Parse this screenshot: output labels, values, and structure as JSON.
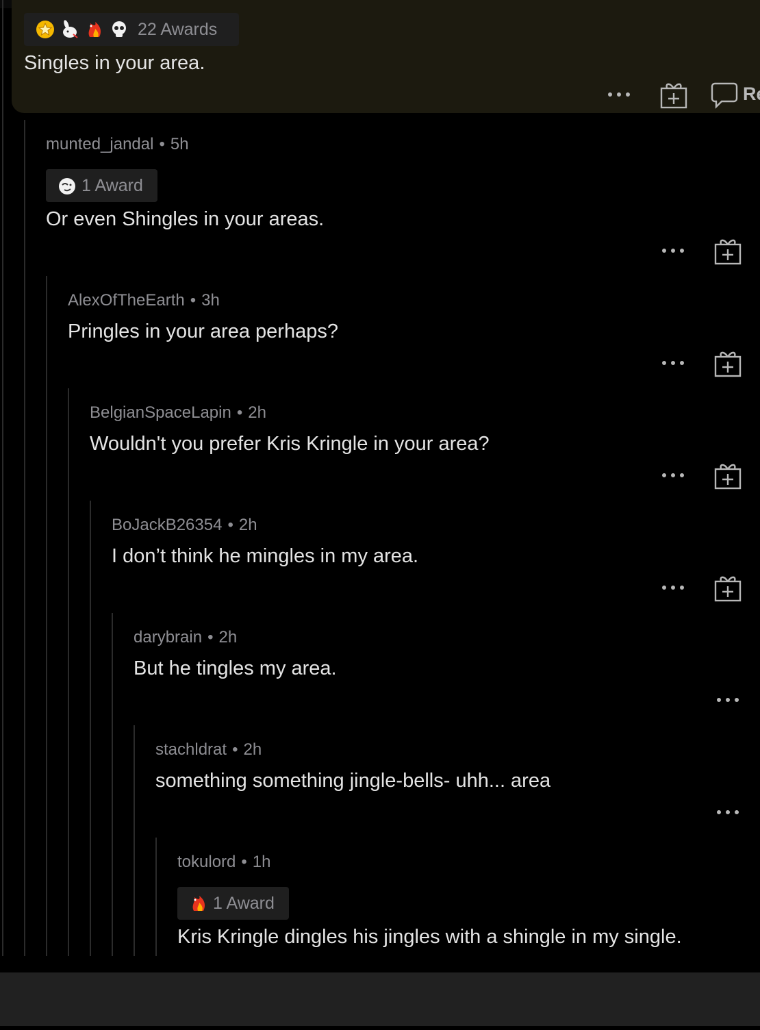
{
  "top_comment": {
    "awards_label": "22 Awards",
    "award_icons": [
      "star-award-icon",
      "rabbit-award-icon",
      "fire-rooster-award-icon",
      "skull-award-icon"
    ],
    "body": "Singles in your area.",
    "reply_label": "Re"
  },
  "comments": [
    {
      "author": "munted_jandal",
      "sep": "•",
      "age": "5h",
      "awards_label": "1 Award",
      "body": "Or even Shingles in your areas."
    },
    {
      "author": "AlexOfTheEarth",
      "sep": "•",
      "age": "3h",
      "body": "Pringles in your area perhaps?"
    },
    {
      "author": "BelgianSpaceLapin",
      "sep": "•",
      "age": "2h",
      "body": "Wouldn't you prefer Kris Kringle in your area?"
    },
    {
      "author": "BoJackB26354",
      "sep": "•",
      "age": "2h",
      "body": "I don’t think he mingles in my area."
    },
    {
      "author": "darybrain",
      "sep": "•",
      "age": "2h",
      "body": "But he tingles my area."
    },
    {
      "author": "stachldrat",
      "sep": "•",
      "age": "2h",
      "body": "something something jingle-bells- uhh... area"
    },
    {
      "author": "tokulord",
      "sep": "•",
      "age": "1h",
      "awards_label": "1 Award",
      "body": "Kris Kringle dingles his jingles with a shingle in my single."
    }
  ],
  "colors": {
    "background": "#000000",
    "highlight": "#1c1a0f",
    "meta": "#8e8e93",
    "body": "#e4e4e4",
    "thread_line": "#2b2b2b"
  }
}
